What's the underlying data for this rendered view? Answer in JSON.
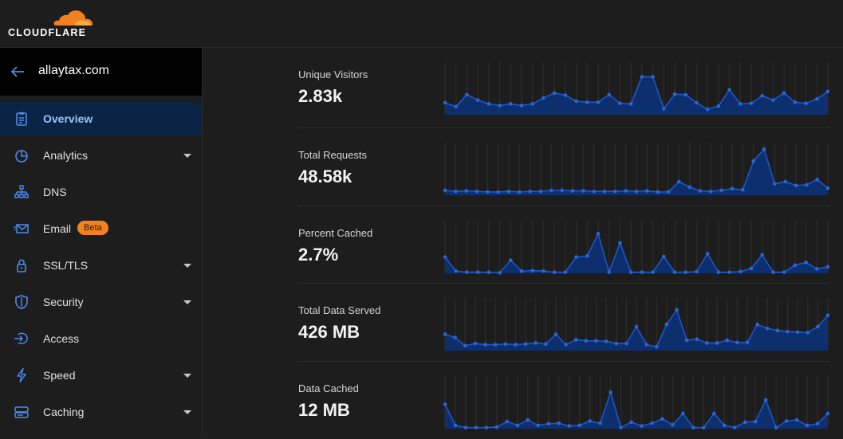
{
  "brand": {
    "name": "CLOUDFLARE",
    "orange": "#f48120",
    "accent": "#2f6fe0"
  },
  "site": {
    "name": "allaytax.com"
  },
  "nav": [
    {
      "label": "Overview",
      "icon": "clipboard-icon",
      "active": true,
      "expandable": false
    },
    {
      "label": "Analytics",
      "icon": "pie-chart-icon",
      "active": false,
      "expandable": true
    },
    {
      "label": "DNS",
      "icon": "network-icon",
      "active": false,
      "expandable": false
    },
    {
      "label": "Email",
      "icon": "envelope-icon",
      "active": false,
      "expandable": false,
      "badge": "Beta"
    },
    {
      "label": "SSL/TLS",
      "icon": "lock-icon",
      "active": false,
      "expandable": true
    },
    {
      "label": "Security",
      "icon": "shield-icon",
      "active": false,
      "expandable": true
    },
    {
      "label": "Access",
      "icon": "access-icon",
      "active": false,
      "expandable": false
    },
    {
      "label": "Speed",
      "icon": "lightning-icon",
      "active": false,
      "expandable": true
    },
    {
      "label": "Caching",
      "icon": "storage-icon",
      "active": false,
      "expandable": true
    }
  ],
  "metrics": [
    {
      "label": "Unique Visitors",
      "value": "2.83k",
      "series": [
        22,
        15,
        37,
        27,
        20,
        17,
        20,
        17,
        20,
        31,
        40,
        36,
        25,
        23,
        23,
        37,
        21,
        20,
        70,
        70,
        11,
        38,
        37,
        22,
        10,
        16,
        46,
        20,
        21,
        35,
        27,
        40,
        23,
        21,
        29,
        43
      ]
    },
    {
      "label": "Total Requests",
      "value": "48.58k",
      "series": [
        9,
        7,
        8,
        7,
        6,
        6,
        7,
        6,
        7,
        7,
        9,
        9,
        8,
        8,
        7,
        7,
        7,
        8,
        7,
        8,
        6,
        6,
        25,
        15,
        8,
        7,
        9,
        12,
        10,
        63,
        85,
        21,
        25,
        18,
        19,
        29,
        13
      ]
    },
    {
      "label": "Percent Cached",
      "value": "2.7%",
      "series": [
        30,
        4,
        2,
        2,
        2,
        1,
        24,
        4,
        5,
        4,
        2,
        2,
        30,
        32,
        73,
        2,
        56,
        2,
        2,
        2,
        31,
        2,
        2,
        3,
        36,
        2,
        2,
        3,
        9,
        34,
        2,
        2,
        15,
        20,
        8,
        12
      ]
    },
    {
      "label": "Total Data Served",
      "value": "426 MB",
      "series": [
        30,
        24,
        9,
        13,
        11,
        11,
        12,
        11,
        12,
        14,
        12,
        30,
        11,
        20,
        18,
        18,
        17,
        13,
        13,
        44,
        11,
        7,
        48,
        75,
        19,
        21,
        14,
        14,
        19,
        15,
        15,
        48,
        41,
        37,
        35,
        34,
        33,
        44,
        65
      ]
    },
    {
      "label": "Data Cached",
      "value": "12 MB",
      "series": [
        45,
        6,
        2,
        2,
        2,
        3,
        13,
        6,
        16,
        6,
        9,
        10,
        5,
        6,
        14,
        10,
        67,
        2,
        12,
        5,
        10,
        18,
        7,
        28,
        2,
        2,
        28,
        6,
        2,
        12,
        13,
        53,
        2,
        14,
        16,
        6,
        9,
        28
      ]
    }
  ]
}
